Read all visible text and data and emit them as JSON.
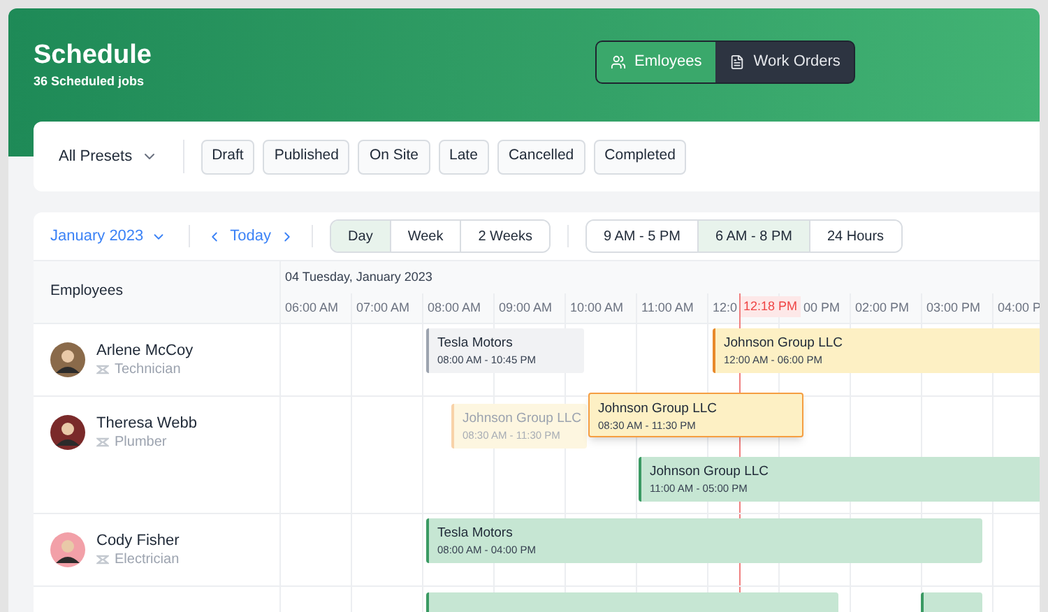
{
  "header": {
    "title": "Schedule",
    "subtitle": "36 Scheduled jobs"
  },
  "view_toggle": [
    {
      "label": "Emloyees",
      "selected": true
    },
    {
      "label": "Work Orders",
      "selected": false
    }
  ],
  "presets": {
    "label": "All Presets"
  },
  "filters": [
    "Draft",
    "Published",
    "On Site",
    "Late",
    "Cancelled",
    "Completed"
  ],
  "toolbar": {
    "month": "January 2023",
    "today": "Today",
    "ranges": [
      {
        "label": "Day",
        "selected": true
      },
      {
        "label": "Week",
        "selected": false
      },
      {
        "label": "2 Weeks",
        "selected": false
      }
    ],
    "hours": [
      {
        "label": "9 AM - 5 PM",
        "selected": false
      },
      {
        "label": "6 AM - 8 PM",
        "selected": true
      },
      {
        "label": "24 Hours",
        "selected": false
      }
    ]
  },
  "grid": {
    "column_title": "Employees",
    "date": "04 Tuesday, January 2023",
    "times": [
      "06:00 AM",
      "07:00 AM",
      "08:00 AM",
      "09:00 AM",
      "10:00 AM",
      "11:00 AM",
      "12:0",
      "00 PM",
      "02:00 PM",
      "03:00 PM",
      "04:00 P"
    ],
    "now": "12:18 PM",
    "rows": [
      {
        "name": "Arlene McCoy",
        "role": "Technician",
        "events": [
          {
            "kind": "plain",
            "color": "#f1f2f4",
            "title": "Tesla Motors",
            "time": "08:00 AM - 10:45 PM"
          },
          {
            "kind": "plain",
            "color": "#fdf0c4",
            "title": "Johnson Group LLC",
            "time": "12:00 AM - 06:00 PM"
          }
        ]
      },
      {
        "name": "Theresa Webb",
        "role": "Plumber",
        "events": [
          {
            "kind": "ghost",
            "color": "#fdf6e0",
            "title": "Johnson Group LLC",
            "time": "08:30 AM - 11:30 PM"
          },
          {
            "kind": "dragging",
            "color": "#fdf0c4",
            "title": "Johnson Group LLC",
            "time": "08:30 AM - 11:30 PM"
          },
          {
            "kind": "plain",
            "color": "#c6e6d3",
            "title": "Johnson Group LLC",
            "time": "11:00 AM - 05:00 PM"
          }
        ]
      },
      {
        "name": "Cody Fisher",
        "role": "Electrician",
        "events": [
          {
            "kind": "plain",
            "color": "#c6e6d3",
            "title": "Tesla Motors",
            "time": "08:00 AM - 04:00 PM"
          }
        ]
      },
      {
        "events": [
          {
            "kind": "plain",
            "color": "#c6e6d3"
          },
          {
            "kind": "plain",
            "color": "#c6e6d3"
          }
        ]
      }
    ]
  }
}
